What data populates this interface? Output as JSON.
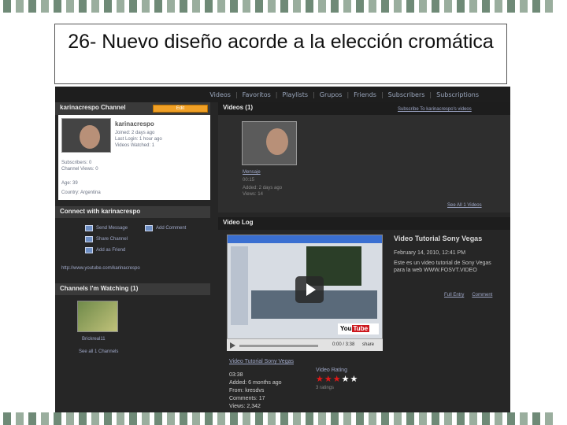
{
  "slide": {
    "title": "26- Nuevo diseño acorde a la elección cromática"
  },
  "topnav": [
    "Videos",
    "Favoritos",
    "Playlists",
    "Grupos",
    "Friends",
    "Subscribers",
    "Subscriptions"
  ],
  "channel": {
    "header": "karinacrespo Channel",
    "edit_label": "Edit",
    "username": "karinacrespo",
    "joined": "Joined: 2 days ago",
    "last_login": "Last Login: 1 hour ago",
    "videos_watched": "Videos Watched: 1",
    "subscribers": "Subscribers: 0",
    "channel_views": "Channel Views: 0",
    "age": "Age: 39",
    "country": "Country: Argentina"
  },
  "connect": {
    "header": "Connect with karinacrespo",
    "send_message": "Send Message",
    "add_comment": "Add Comment",
    "share_channel": "Share Channel",
    "add_as_friend": "Add as Friend",
    "footer": "http://www.youtube.com/karinacrespo"
  },
  "watching": {
    "header": "Channels I'm Watching (1)",
    "channel_name": "Brickreal11",
    "see_all": "See all 1 Channels"
  },
  "videos": {
    "header": "Videos (1)",
    "subscribe": "Subscribe To karinacrespo's videos",
    "thumb_title": "Mensaje",
    "duration": "00:15",
    "added": "Added: 2 days ago",
    "views": "Views: 14",
    "see_all": "See All 1 Videos"
  },
  "video_log": {
    "header": "Video Log",
    "logo_you": "You",
    "logo_tube": "Tube",
    "controls_time": "0:00 / 3:38",
    "share_label": "share",
    "title": "Video Tutorial Sony Vegas",
    "date": "February 14, 2010, 12:41 PM",
    "description": "Este es un video tutorial de Sony Vegas para la web WWW.FOSVT.VIDEO",
    "link1": "Full Entry",
    "link2": "Comment",
    "below_title": "Video Tutorial Sony Vegas",
    "rating_label": "Video Rating",
    "ratings_count": "3 ratings",
    "rating_value": 3,
    "rating_max": 5,
    "meta_duration": "03:38",
    "meta_added": "Added: 6 months ago",
    "meta_from": "From: kresdvs",
    "meta_comments": "Comments: 17",
    "meta_views": "Views: 2,342"
  }
}
